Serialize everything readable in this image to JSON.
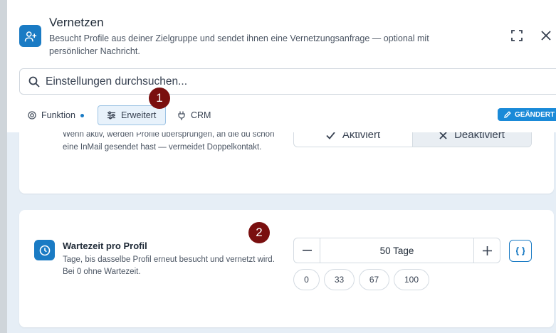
{
  "header": {
    "icon": "add-user-icon",
    "title": "Vernetzen",
    "subtitle": "Besucht Profile aus deiner Zielgruppe und sendet ihnen eine Vernetzungsanfrage — optional mit persönlicher Nachricht."
  },
  "search": {
    "placeholder": "Einstellungen durchsuchen..."
  },
  "tabs": [
    {
      "label": "Funktion",
      "icon": "target-icon",
      "has_dot": true,
      "active": false
    },
    {
      "label": "Erweitert",
      "icon": "sliders-icon",
      "has_dot": false,
      "active": true
    },
    {
      "label": "CRM",
      "icon": "plug-icon",
      "has_dot": false,
      "active": false
    }
  ],
  "badge": {
    "label": "GEÄNDERT",
    "icon": "pencil-icon"
  },
  "settings": [
    {
      "description": "Wenn aktiv, werden Profile übersprungen, an die du schon eine InMail gesendet hast — vermeidet Doppelkontakt.",
      "options": [
        {
          "label": "Aktiviert",
          "icon": "check-icon",
          "selected": false
        },
        {
          "label": "Deaktiviert",
          "icon": "x-icon",
          "selected": true
        }
      ]
    },
    {
      "title": "Wartezeit pro Profil",
      "icon": "clock-icon",
      "description": "Tage, bis dasselbe Profil erneut besucht und vernetzt wird. Bei 0 ohne Wartezeit.",
      "value": "50 Tage",
      "presets": [
        "0",
        "33",
        "67",
        "100"
      ]
    }
  ],
  "markers": [
    "1",
    "2"
  ],
  "colors": {
    "accent": "#1a7bc4",
    "badge": "#1a8ad8",
    "marker": "#7a0f0f",
    "content_bg": "#e6eef6"
  }
}
